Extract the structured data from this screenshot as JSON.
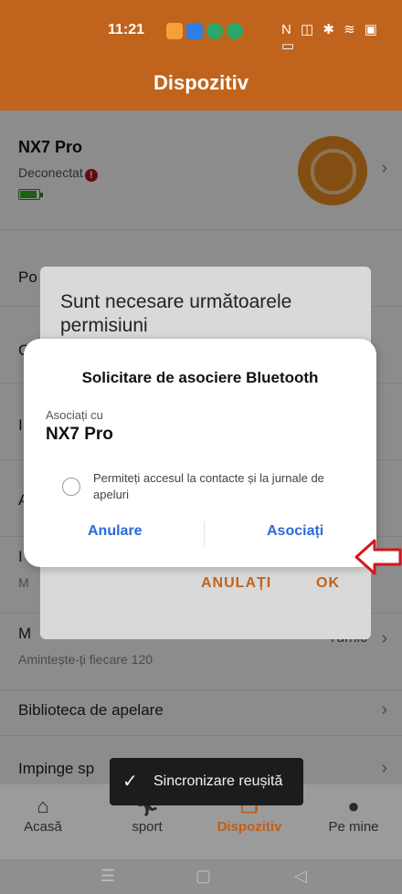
{
  "status_bar": {
    "time": "11:21",
    "system_icons": "N ◫ ✱ ≋ ▣ ▭"
  },
  "header": {
    "title": "Dispozitiv"
  },
  "device": {
    "name": "NX7 Pro",
    "status": "Deconectat",
    "warning_glyph": "!",
    "battery_level": 0.8
  },
  "settings_list": [
    {
      "label": "Po"
    },
    {
      "label": "C"
    },
    {
      "label": "I"
    },
    {
      "label": "A"
    },
    {
      "label": "I",
      "sub": "M"
    },
    {
      "label": "M",
      "sub": "Amintește-ți fiecare 120",
      "value": "Tumic"
    },
    {
      "label": "Biblioteca de apelare"
    },
    {
      "label": "Impinge sp"
    }
  ],
  "permission_dialog": {
    "title": "Sunt necesare următoarele permisiuni",
    "cancel": "ANULAȚI",
    "ok": "OK"
  },
  "bluetooth_dialog": {
    "title": "Solicitare de asociere Bluetooth",
    "pair_with_label": "Asociați cu",
    "device_name": "NX7 Pro",
    "checkbox_label": "Permiteți accesul la contacte și la jurnale de apeluri",
    "cancel": "Anulare",
    "confirm": "Asociați"
  },
  "toast": {
    "message": "Sincronizare reușită"
  },
  "bottom_nav": [
    {
      "label": "Acasă",
      "icon": "home-icon"
    },
    {
      "label": "sport",
      "icon": "running-icon"
    },
    {
      "label": "Dispozitiv",
      "icon": "device-icon",
      "active": true
    },
    {
      "label": "Pe mine",
      "icon": "person-icon"
    }
  ],
  "colors": {
    "brand": "#c0631c",
    "link_blue": "#2c6bd6",
    "arrow_red": "#d4161c"
  }
}
